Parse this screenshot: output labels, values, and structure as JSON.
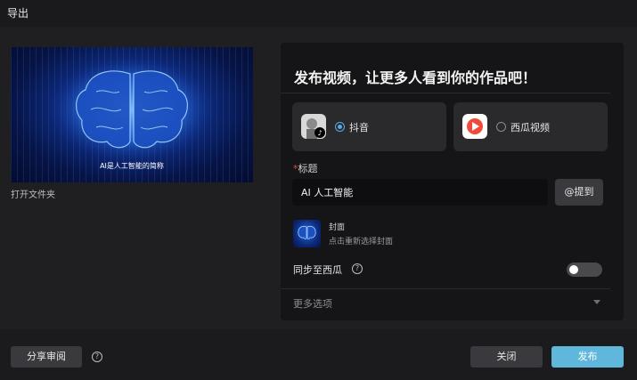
{
  "window": {
    "title": "导出"
  },
  "preview": {
    "caption": "AI是人工智能的简称",
    "open_folder": "打开文件夹"
  },
  "publish": {
    "heading": "发布视频，让更多人看到你的作品吧！",
    "platforms": [
      {
        "label": "抖音",
        "selected": true,
        "icon": "douyin-avatar-icon"
      },
      {
        "label": "西瓜视频",
        "selected": false,
        "icon": "xigua-video-icon"
      }
    ],
    "title_label": "标题",
    "title_required_mark": "*",
    "title_value": "AI 人工智能",
    "mention_label": "@提到",
    "cover_label": "封面",
    "cover_hint": "点击重新选择封面",
    "sync_label": "同步至西瓜",
    "sync_enabled": false,
    "more_options": "更多选项"
  },
  "footer": {
    "share_review": "分享审阅",
    "close": "关闭",
    "publish": "发布",
    "help_glyph": "?"
  },
  "colors": {
    "accent": "#5fb7dc",
    "radio_active": "#5aa9e6",
    "required": "#e0504a"
  }
}
